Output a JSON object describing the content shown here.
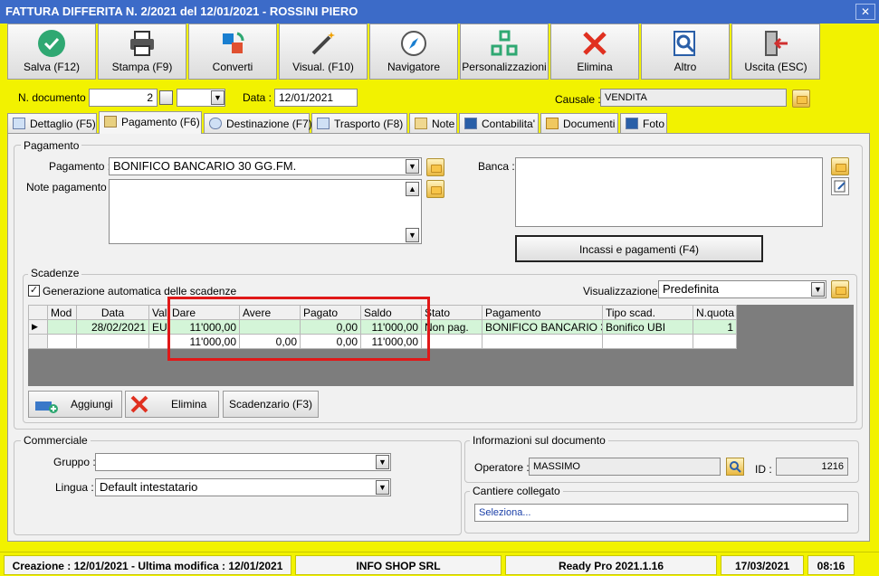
{
  "window": {
    "title": "FATTURA DIFFERITA N. 2/2021 del 12/01/2021 - ROSSINI PIERO",
    "close_glyph": "✕"
  },
  "toolbar": [
    {
      "label": "Salva (F12)",
      "icon": "save-check-icon",
      "color": "#2fa872"
    },
    {
      "label": "Stampa (F9)",
      "icon": "printer-icon",
      "color": "#333333"
    },
    {
      "label": "Converti",
      "icon": "convert-icon",
      "color": "#1a7fd0"
    },
    {
      "label": "Visual. (F10)",
      "icon": "magic-wand-icon",
      "color": "#444444"
    },
    {
      "label": "Navigatore",
      "icon": "compass-icon",
      "color": "#666666"
    },
    {
      "label": "Personalizzazioni",
      "icon": "grid-icon",
      "color": "#2fa872"
    },
    {
      "label": "Elimina",
      "icon": "delete-x-icon",
      "color": "#e03020"
    },
    {
      "label": "Altro",
      "icon": "search-doc-icon",
      "color": "#2a5fa8"
    },
    {
      "label": "Uscita (ESC)",
      "icon": "exit-door-icon",
      "color": "#d03030"
    }
  ],
  "header": {
    "doc_label": "N. documento :",
    "doc_value": "2",
    "data_label": "Data :",
    "data_value": "12/01/2021",
    "causale_label": "Causale :",
    "causale_value": "VENDITA"
  },
  "tabs": [
    "Dettaglio (F5)",
    "Pagamento (F6)",
    "Destinazione (F7)",
    "Trasporto (F8)",
    "Note",
    "Contabilita'",
    "Documenti",
    "Foto"
  ],
  "pagamento": {
    "group_title": "Pagamento",
    "pag_label": "Pagamento :",
    "pag_value": "BONIFICO BANCARIO 30 GG.FM.",
    "note_label": "Note pagamento :",
    "note_value": "",
    "banca_label": "Banca :",
    "banca_value": "",
    "incassi_button": "Incassi e pagamenti (F4)"
  },
  "scadenze": {
    "group_title": "Scadenze",
    "auto_label": "Generazione automatica delle scadenze",
    "auto_checked": true,
    "vis_label": "Visualizzazione :",
    "vis_value": "Predefinita",
    "columns": [
      "Mod",
      "Data",
      "Val",
      "Dare",
      "Avere",
      "Pagato",
      "Saldo",
      "Stato",
      "Pagamento",
      "Tipo scad.",
      "N.quota"
    ],
    "rows": [
      {
        "mod": "",
        "data": "28/02/2021",
        "val": "EU",
        "dare": "11'000,00",
        "avere": "",
        "pagato": "0,00",
        "saldo": "11'000,00",
        "stato": "Non pag.",
        "pagamento": "BONIFICO BANCARIO 3...",
        "tipo": "Bonifico UBI",
        "nquota": "1"
      }
    ],
    "totals": {
      "dare": "11'000,00",
      "avere": "0,00",
      "pagato": "0,00",
      "saldo": "11'000,00"
    },
    "buttons": {
      "aggiungi": "Aggiungi",
      "elimina": "Elimina",
      "scadenzario": "Scadenzario (F3)"
    }
  },
  "commerciale": {
    "group_title": "Commerciale",
    "gruppo_label": "Gruppo :",
    "gruppo_value": "",
    "lingua_label": "Lingua :",
    "lingua_value": "Default intestatario"
  },
  "info": {
    "group_title": "Informazioni sul documento",
    "operatore_label": "Operatore :",
    "operatore_value": "MASSIMO",
    "id_label": "ID :",
    "id_value": "1216"
  },
  "cantiere": {
    "group_title": "Cantiere collegato",
    "value": "Seleziona..."
  },
  "statusbar": {
    "creazione": "Creazione : 12/01/2021 - Ultima modifica : 12/01/2021",
    "company": "INFO SHOP SRL",
    "version": "Ready Pro 2021.1.16",
    "date": "17/03/2021",
    "time": "08:16"
  },
  "colors": {
    "background": "#f2f200",
    "titlebar": "#3c6bc8",
    "highlight": "#e01818",
    "row_selected": "#d4f5d8"
  }
}
